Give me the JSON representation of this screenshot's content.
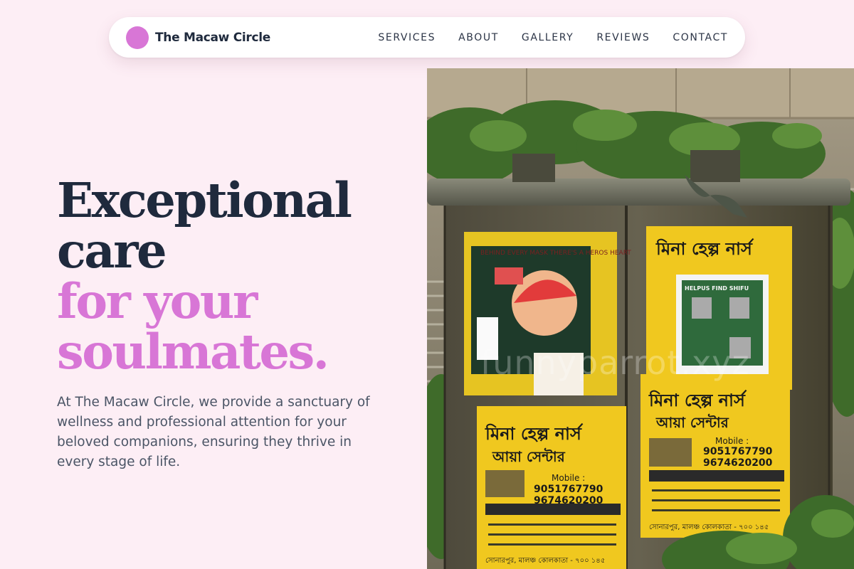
{
  "brand": {
    "name": "The Macaw Circle",
    "dot_color": "#d876d6"
  },
  "nav": {
    "links": [
      {
        "label": "SERVICES"
      },
      {
        "label": "ABOUT"
      },
      {
        "label": "GALLERY"
      },
      {
        "label": "REVIEWS"
      },
      {
        "label": "CONTACT"
      }
    ]
  },
  "hero": {
    "title_line1": "Exceptional",
    "title_line2": "care",
    "title_line3": "for your",
    "title_line4": "soulmates.",
    "description": "At The Macaw Circle, we provide a sanctuary of wellness and professional attention for your beloved companions, ensuring they thrive in every stage of life."
  },
  "photo": {
    "watermark": "funnyparrot.xyz",
    "poster_heading": "মিনা হেল্প নার্স",
    "poster_subheading": "আয়া সেন্টার",
    "poster_mobile_label": "Mobile :",
    "poster_phone1": "9051767790",
    "poster_phone2": "9674620200",
    "poster_footer": "সোনারপুর, মালঞ্চ কোলকাতা - ৭০০ ১৪৫",
    "notice_title": "HELPUS FIND SHIFU",
    "art_text": "BEHIND EVERY MASK THERE'S A HEROS HEART"
  },
  "colors": {
    "accent": "#d876d6",
    "heading": "#1f2a3d",
    "background": "#fdeef5"
  }
}
